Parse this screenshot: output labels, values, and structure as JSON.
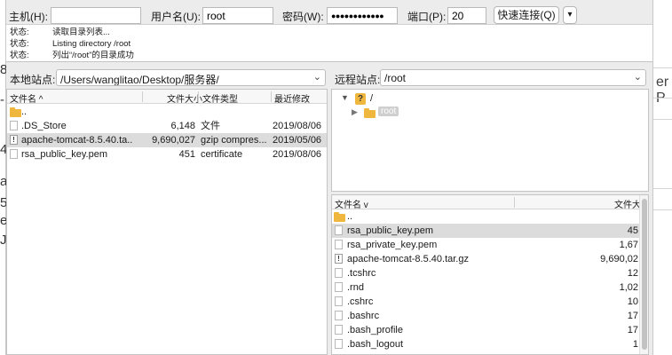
{
  "quickconnect": {
    "host_label": "主机(H):",
    "host_value": "",
    "user_label": "用户名(U):",
    "user_value": "root",
    "password_label": "密码(W):",
    "password_value": "●●●●●●●●●●●●",
    "port_label": "端口(P):",
    "port_value": "20",
    "connect_button": "快速连接(Q)",
    "dropdown_glyph": "▾"
  },
  "log": [
    {
      "key": "状态:",
      "text": "读取目录列表..."
    },
    {
      "key": "状态:",
      "text": "Listing directory /root"
    },
    {
      "key": "状态:",
      "text": "列出“/root”的目录成功"
    }
  ],
  "local": {
    "site_label": "本地站点:",
    "site_path": "/Users/wanglitao/Desktop/服务器/",
    "columns": {
      "name": "文件名",
      "size": "文件大小",
      "type": "文件类型",
      "modified": "最近修改"
    },
    "sort_glyph": "^",
    "rows": [
      {
        "name": "..",
        "size": "",
        "type": "",
        "modified": "",
        "icon": "folder-icon"
      },
      {
        "name": ".DS_Store",
        "size": "6,148",
        "type": "文件",
        "modified": "2019/08/06",
        "icon": "file-icon"
      },
      {
        "name": "apache-tomcat-8.5.40.ta..",
        "size": "9,690,027",
        "type": "gzip compres...",
        "modified": "2019/05/06",
        "icon": "archive-file-icon"
      },
      {
        "name": "rsa_public_key.pem",
        "size": "451",
        "type": "certificate",
        "modified": "2019/08/06",
        "icon": "file-icon"
      }
    ]
  },
  "remote": {
    "site_label": "远程站点:",
    "site_path": "/root",
    "tree": [
      {
        "label": "/",
        "icon": "question-folder-icon"
      },
      {
        "label": "root",
        "icon": "folder-icon"
      }
    ],
    "columns": {
      "name": "文件名",
      "size": "文件大"
    },
    "sort_glyph": "v",
    "rows": [
      {
        "name": "..",
        "size": "",
        "icon": "folder-icon"
      },
      {
        "name": "rsa_public_key.pem",
        "size": "45",
        "icon": "file-icon"
      },
      {
        "name": "rsa_private_key.pem",
        "size": "1,67",
        "icon": "file-icon"
      },
      {
        "name": "apache-tomcat-8.5.40.tar.gz",
        "size": "9,690,02",
        "icon": "archive-file-icon"
      },
      {
        "name": ".tcshrc",
        "size": "12",
        "icon": "file-icon"
      },
      {
        "name": ".rnd",
        "size": "1,02",
        "icon": "file-icon"
      },
      {
        "name": ".cshrc",
        "size": "10",
        "icon": "file-icon"
      },
      {
        "name": ".bashrc",
        "size": "17",
        "icon": "file-icon"
      },
      {
        "name": ".bash_profile",
        "size": "17",
        "icon": "file-icon"
      },
      {
        "name": ".bash_logout",
        "size": "1",
        "icon": "file-icon"
      }
    ]
  },
  "background": {
    "left_fragments": [
      "8",
      "-",
      "4",
      "a",
      "5",
      "e",
      "J"
    ],
    "right_fragment": "er P"
  }
}
